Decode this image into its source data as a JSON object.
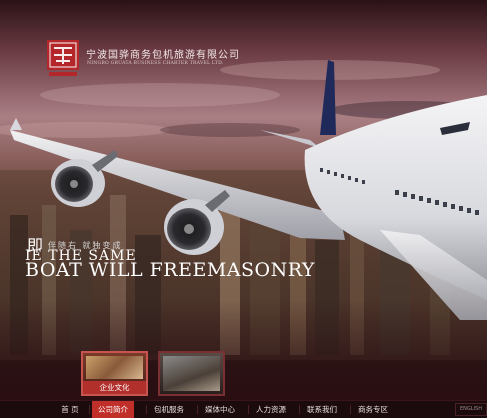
{
  "header": {
    "company_cn": "宁波国骅商务包机旅游有限公司",
    "company_en": "NINGBO GRUATA BUSINESS CHARTER TRAVEL LTD.",
    "logo_seal_text": "国骅"
  },
  "slogan": {
    "glyph": "即",
    "cn": "伴随右 就独变成",
    "line1": "IE THE SAME",
    "line2": "BOAT WILL FREEMASONRY"
  },
  "thumbs": [
    {
      "caption": "企业文化"
    },
    {
      "caption": ""
    }
  ],
  "nav": {
    "items": [
      {
        "label": "首 页",
        "active": false
      },
      {
        "label": "公司简介",
        "active": true
      },
      {
        "label": "包机服务",
        "active": false
      },
      {
        "label": "媒体中心",
        "active": false
      },
      {
        "label": "人力资源",
        "active": false
      },
      {
        "label": "联系我们",
        "active": false
      },
      {
        "label": "商务专区",
        "active": false
      }
    ],
    "lang_label": "ENGLISH"
  },
  "colors": {
    "accent_red": "#c02f2a",
    "nav_bg": "#1b0b0d"
  }
}
